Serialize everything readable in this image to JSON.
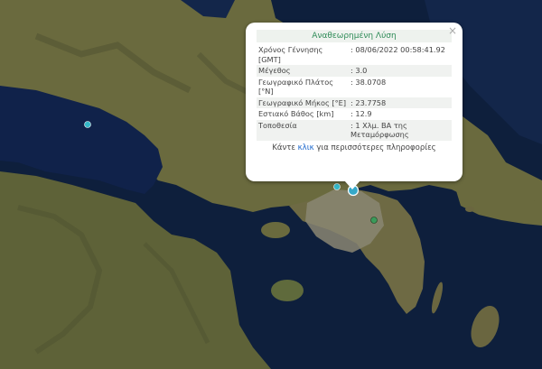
{
  "popup": {
    "title": "Αναθεωρημένη Λύση",
    "close_glyph": "×",
    "rows": [
      {
        "label": "Χρόνος Γέννησης [GMT]",
        "value": ": 08/06/2022 00:58:41.92"
      },
      {
        "label": "Μέγεθος",
        "value": ": 3.0"
      },
      {
        "label": "Γεωγραφικό Πλάτος [°N]",
        "value": ": 38.0708"
      },
      {
        "label": "Γεωγραφικό Μήκος [°E]",
        "value": ": 23.7758"
      },
      {
        "label": "Εστιακό Βάθος [km]",
        "value": ": 12.9"
      },
      {
        "label": "Τοποθεσία",
        "value": ": 1 Χλμ. ΒΑ της Μεταμόρφωσης"
      }
    ],
    "more_prefix": "Κάντε",
    "more_link": "κλικ",
    "more_suffix": "για περισσότερες πληροφορίες"
  },
  "markers": [
    {
      "name": "selected-earthquake-marker",
      "color": "#35a8c8"
    },
    {
      "name": "earthquake-marker-west",
      "color": "#35b8c8"
    },
    {
      "name": "earthquake-marker-near",
      "color": "#35b8c8"
    },
    {
      "name": "earthquake-marker-green",
      "color": "#3a9a5a"
    }
  ],
  "colors": {
    "sea": "#0e1f3c",
    "land": "#6b6840",
    "accent": "#2e8b57",
    "link": "#1a66cc"
  }
}
